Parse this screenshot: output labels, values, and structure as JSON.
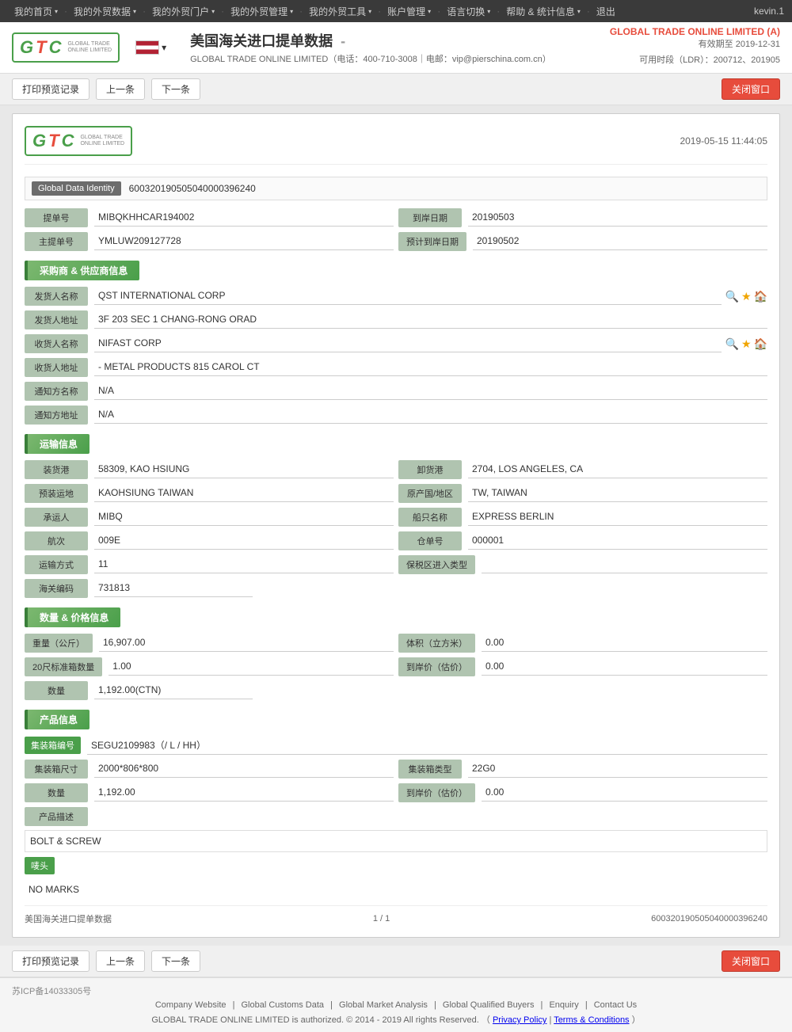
{
  "topnav": {
    "items": [
      {
        "label": "我的首页",
        "id": "home"
      },
      {
        "label": "我的外贸数据",
        "id": "data"
      },
      {
        "label": "我的外贸门户",
        "id": "portal"
      },
      {
        "label": "我的外贸管理",
        "id": "manage"
      },
      {
        "label": "我的外贸工具",
        "id": "tools"
      },
      {
        "label": "账户管理",
        "id": "account"
      },
      {
        "label": "语言切换",
        "id": "lang"
      },
      {
        "label": "帮助 & 统计信息",
        "id": "help"
      },
      {
        "label": "退出",
        "id": "logout"
      }
    ],
    "user": "kevin.1"
  },
  "header": {
    "logo_text": "GLOBAL TRADE ONLINE LIMITED",
    "title": "美国海关进口提单数据",
    "subtitle": "GLOBAL TRADE ONLINE LIMITED（电话：400-710-3008｜电邮：vip@pierschina.com.cn）",
    "company": "GLOBAL TRADE ONLINE LIMITED (A)",
    "valid_until": "有效期至 2019-12-31",
    "ldr": "可用时段（LDR）：200712、201905"
  },
  "toolbar": {
    "print_btn": "打印预览记录",
    "prev_btn": "上一条",
    "next_btn": "下一条",
    "close_btn": "关闭窗口"
  },
  "doc": {
    "timestamp": "2019-05-15 11:44:05",
    "global_data_identity_label": "Global Data Identity",
    "global_data_identity_value": "600320190505040000396240",
    "fields": {
      "提单号_label": "提单号",
      "提单号_value": "MIBQKHHCAR194002",
      "到岸日期_label": "到岸日期",
      "到岸日期_value": "20190503",
      "主提单号_label": "主提单号",
      "主提单号_value": "YMLUW209127728",
      "预计到岸日期_label": "预计到岸日期",
      "预计到岸日期_value": "20190502"
    },
    "section_supplier": "采购商 & 供应商信息",
    "发货人名称_label": "发货人名称",
    "发货人名称_value": "QST INTERNATIONAL CORP",
    "发货人地址_label": "发货人地址",
    "发货人地址_value": "3F 203 SEC 1 CHANG-RONG ORAD",
    "收货人名称_label": "收货人名称",
    "收货人名称_value": "NIFAST CORP",
    "收货人地址_label": "收货人地址",
    "收货人地址_value": "- METAL PRODUCTS 815 CAROL CT",
    "通知方名称_label": "通知方名称",
    "通知方名称_value": "N/A",
    "通知方地址_label": "通知方地址",
    "通知方地址_value": "N/A",
    "section_transport": "运输信息",
    "装货港_label": "装货港",
    "装货港_value": "58309, KAO HSIUNG",
    "卸货港_label": "卸货港",
    "卸货港_value": "2704, LOS ANGELES, CA",
    "预装运地_label": "预装运地",
    "预装运地_value": "KAOHSIUNG TAIWAN",
    "原产国地区_label": "原产国/地区",
    "原产国地区_value": "TW, TAIWAN",
    "承运人_label": "承运人",
    "承运人_value": "MIBQ",
    "船只名称_label": "船只名称",
    "船只名称_value": "EXPRESS BERLIN",
    "航次_label": "航次",
    "航次_value": "009E",
    "仓单号_label": "仓单号",
    "仓单号_value": "000001",
    "运输方式_label": "运输方式",
    "运输方式_value": "11",
    "保税区进入类型_label": "保税区进入类型",
    "保税区进入类型_value": "",
    "海关编码_label": "海关编码",
    "海关编码_value": "731813",
    "section_quantity": "数量 & 价格信息",
    "重量_label": "重量（公斤）",
    "重量_value": "16,907.00",
    "体积_label": "体积（立方米）",
    "体积_value": "0.00",
    "20尺_label": "20尺标准箱数量",
    "20尺_value": "1.00",
    "到岸价_label": "到岸价（估价）",
    "到岸价_value": "0.00",
    "数量_label": "数量",
    "数量_value": "1,192.00(CTN)",
    "section_product": "产品信息",
    "集装箱编号_label": "集装箱编号",
    "集装箱编号_value": "SEGU2109983（/ L / HH）",
    "集装箱尺寸_label": "集装箱尺寸",
    "集装箱尺寸_value": "2000*806*800",
    "集装箱类型_label": "集装箱类型",
    "集装箱类型_value": "22G0",
    "产品数量_label": "数量",
    "产品数量_value": "1,192.00",
    "产品到岸价_label": "到岸价（估价）",
    "产品到岸价_value": "0.00",
    "产品描述_label": "产品描述",
    "产品描述_value": "BOLT & SCREW",
    "唛头_label": "唛头",
    "唛头_value": "NO MARKS"
  },
  "doc_footer": {
    "title": "美国海关进口提单数据",
    "page": "1 / 1",
    "id": "600320190505040000396240"
  },
  "page_footer": {
    "links": [
      "Company Website",
      "Global Customs Data",
      "Global Market Analysis",
      "Global Qualified Buyers",
      "Enquiry",
      "Contact Us"
    ],
    "copyright": "GLOBAL TRADE ONLINE LIMITED is authorized. © 2014 - 2019 All rights Reserved.",
    "privacy": "Privacy Policy",
    "terms": "Terms & Conditions",
    "icp": "苏ICP备14033305号"
  }
}
